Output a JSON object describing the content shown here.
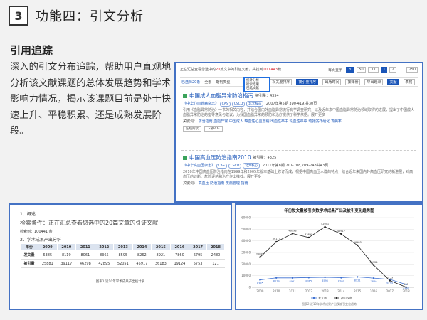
{
  "header": {
    "number": "3",
    "title": "功能四：引文分析"
  },
  "section": {
    "heading": "引用追踪",
    "body": "深入的引文分布追踪，帮助用户直观地分析该文献课题的总体发展趋势和学术影响力情况，揭示该课题目前是处于快速上升、平稳积累、还是成熟发展阶段。"
  },
  "panel1": {
    "summary_pre": "正在汇总查看您选中的",
    "summary_count": "20",
    "summary_mid": "篇文章的引证文献，共找到",
    "summary_total": "100,443",
    "summary_post": "篇",
    "per_page": "每页显示",
    "page_opts": [
      "20",
      "50",
      "100"
    ],
    "pages": [
      "1",
      "2",
      "...",
      "250"
    ],
    "toolbar": {
      "selected": "已选择20条",
      "all": "全部",
      "journal": "期刊类型",
      "menu_items": [
        "统计分析",
        "检索结果",
        "已选文献"
      ],
      "btns": [
        "相关度排序",
        "被引量排序",
        "出版时间",
        "按年份",
        "导出题录"
      ],
      "view_label": "文献",
      "view2": "表格"
    },
    "records": [
      {
        "title": "中国成人血脂异常防治指南",
        "cited": "被引量：4354",
        "source": "《中华心血管病杂志》",
        "tags": [
          "CAS",
          "CSCD",
          "北大核心"
        ],
        "date": "2007年第5期 390-419,共30页",
        "abstract": "引用《血脂异常防治》一书的相关内容，并结合国内外血脂异常流行病学调查研究，以及近年来中国血脂异常防治领域取得的进展，提出了中国成人血脂异常防治的指导意见与建议，为我国血脂异常的预防和治疗提供了科学依据。展开更多",
        "keywords_label": "关键词：",
        "keywords": [
          "防治指南",
          "血脂异常",
          "中国成人",
          "缺血性心血管病",
          "出血性卒中",
          "缺血性卒中",
          "动脉粥样硬化",
          "发病率"
        ],
        "btn_online": "在线阅读",
        "btn_pdf": "下载PDF"
      },
      {
        "title": "中国高血压防治指南2010",
        "cited": "被引量：4325",
        "source": "《中华高血压杂志》",
        "tags": [
          "CAS",
          "CSCD",
          "北大核心"
        ],
        "date": "2011年第8期 701-708,709-743共43页",
        "abstract": "2010年中国高血压防治指南在1999年和2005年版本基础上修订而成，根据中国高血压人群的特点，结合近年来国内外高血压研究的新进展，对高血压的诊断、危险评估和治疗作出推荐。展开更多",
        "keywords_label": "关键词：",
        "keywords": [
          "高血压",
          "防治指南",
          "疾病管理",
          "指南"
        ]
      }
    ]
  },
  "panel2": {
    "sec1": "1、概述",
    "condition": "检索条件：正在汇总查看您选中的20篇文章的引证文献",
    "count": "检索到：100441 条",
    "sec2": "2、学术成果产出分析",
    "headers": [
      "年份",
      "2009",
      "2010",
      "2011",
      "2012",
      "2013",
      "2014",
      "2015",
      "2016",
      "2017",
      "2018"
    ],
    "rows": [
      {
        "label": "发文量",
        "values": [
          "6385",
          "8119",
          "8061",
          "8365",
          "8595",
          "8262",
          "8921",
          "7860",
          "6795",
          "2480"
        ]
      },
      {
        "label": "被引量",
        "values": [
          "25881",
          "39117",
          "46298",
          "42895",
          "52051",
          "45917",
          "36183",
          "19124",
          "5753",
          "121"
        ]
      }
    ],
    "caption": "图表1 近10年学术成果产出统计表"
  },
  "panel3": {
    "title": "年份发文量被引次数学术成果产出及被引变化趋势图",
    "note": "图表2 近10年学术成果产出及被引变化趋势",
    "legend": [
      "发文量",
      "被引次数"
    ]
  },
  "chart_data": {
    "type": "line",
    "title": "年份发文量被引次数学术成果产出及被引变化趋势图",
    "xlabel": "",
    "ylabel": "",
    "x": [
      "2009",
      "2010",
      "2011",
      "2012",
      "2013",
      "2014",
      "2015",
      "2016",
      "2017",
      "2018"
    ],
    "series": [
      {
        "name": "发文量",
        "values": [
          6385,
          8119,
          8061,
          8365,
          8595,
          8262,
          8921,
          7860,
          6795,
          2480
        ],
        "color": "#3c6fd1"
      },
      {
        "name": "被引次数",
        "values": [
          25881,
          39117,
          46298,
          42895,
          52051,
          45917,
          36183,
          19124,
          5753,
          121
        ],
        "color": "#222222"
      }
    ],
    "ylim": [
      0,
      60000
    ],
    "grid": true,
    "legend_position": "bottom"
  }
}
